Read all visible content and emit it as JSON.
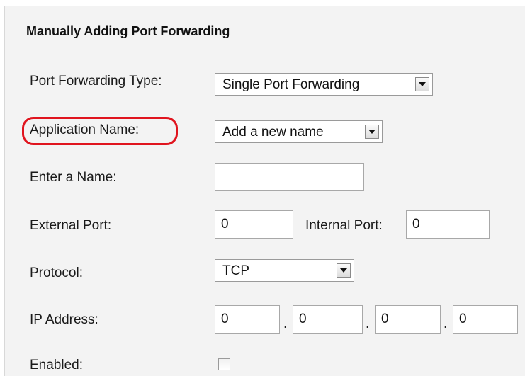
{
  "form": {
    "title": "Manually Adding Port Forwarding",
    "port_forwarding_type": {
      "label": "Port Forwarding Type:",
      "selected": "Single Port Forwarding"
    },
    "application_name": {
      "label": "Application Name:",
      "selected": "Add a new name",
      "highlight_color": "#e0141e"
    },
    "enter_name": {
      "label": "Enter a Name:",
      "value": ""
    },
    "external_port": {
      "label": "External Port:",
      "value": "0"
    },
    "internal_port": {
      "label": "Internal Port:",
      "value": "0"
    },
    "protocol": {
      "label": "Protocol:",
      "selected": "TCP"
    },
    "ip_address": {
      "label": "IP Address:",
      "octets": [
        "0",
        "0",
        "0",
        "0"
      ],
      "separator": "."
    },
    "enabled": {
      "label": "Enabled:",
      "checked": false
    }
  },
  "icons": {
    "dropdown_arrow": "chevron-down-icon"
  },
  "colors": {
    "panel_background": "#f3f3f3",
    "highlight_outline": "#e0141e"
  }
}
